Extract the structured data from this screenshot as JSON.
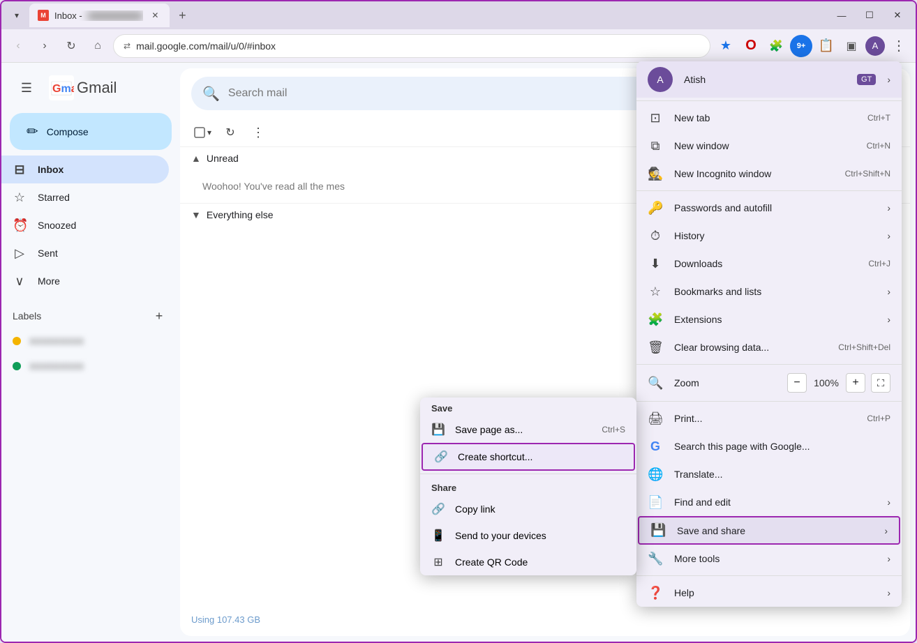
{
  "browser": {
    "tab": {
      "favicon": "M",
      "title": "Inbox -",
      "title_blurred": "     "
    },
    "address": "mail.google.com/mail/u/0/#inbox",
    "window_controls": {
      "minimize": "—",
      "maximize": "☐",
      "close": "✕"
    }
  },
  "toolbar_icons": {
    "star_label": "★",
    "opera_label": "O",
    "extension_label": "🧩",
    "extensions_badge": "9+",
    "clipboard_label": "📋",
    "sidebar_label": "▣",
    "profile_label": "👤",
    "menu_label": "⋮"
  },
  "gmail": {
    "logo_text": "Gmail",
    "compose_label": "Compose",
    "search_placeholder": "Search mail",
    "nav": [
      {
        "id": "inbox",
        "label": "Inbox",
        "icon": "⊟",
        "active": true
      },
      {
        "id": "starred",
        "label": "Starred",
        "icon": "☆",
        "active": false
      },
      {
        "id": "snoozed",
        "label": "Snoozed",
        "icon": "⏰",
        "active": false
      },
      {
        "id": "sent",
        "label": "Sent",
        "icon": "▷",
        "active": false
      },
      {
        "id": "more",
        "label": "More",
        "icon": "∨",
        "active": false
      }
    ],
    "labels_title": "Labels",
    "labels": [
      {
        "id": "label1",
        "color": "#f4b400",
        "text": "XXXXXXXXX"
      },
      {
        "id": "label2",
        "color": "#0f9d58",
        "text": "XXXXXXXXX"
      }
    ],
    "unread_section": "Unread",
    "unread_message": "Woohoo! You've read all the mes",
    "everything_else_section": "Everything else",
    "storage_info": "Using 107.43 GB"
  },
  "chrome_menu": {
    "user": {
      "name": "Atish",
      "badge": "GT",
      "avatar_initials": "A"
    },
    "items": [
      {
        "id": "new-tab",
        "icon": "⊡",
        "label": "New tab",
        "shortcut": "Ctrl+T",
        "arrow": ""
      },
      {
        "id": "new-window",
        "icon": "⧉",
        "label": "New window",
        "shortcut": "Ctrl+N",
        "arrow": ""
      },
      {
        "id": "new-incognito",
        "icon": "🕵",
        "label": "New Incognito window",
        "shortcut": "Ctrl+Shift+N",
        "arrow": ""
      },
      {
        "id": "passwords",
        "icon": "🔑",
        "label": "Passwords and autofill",
        "shortcut": "",
        "arrow": "›"
      },
      {
        "id": "history",
        "icon": "⏱",
        "label": "History",
        "shortcut": "",
        "arrow": "›"
      },
      {
        "id": "downloads",
        "icon": "⬇",
        "label": "Downloads",
        "shortcut": "Ctrl+J",
        "arrow": ""
      },
      {
        "id": "bookmarks",
        "icon": "☆",
        "label": "Bookmarks and lists",
        "shortcut": "",
        "arrow": "›"
      },
      {
        "id": "extensions",
        "icon": "🧩",
        "label": "Extensions",
        "shortcut": "",
        "arrow": "›"
      },
      {
        "id": "clear-browsing",
        "icon": "🗑",
        "label": "Clear browsing data...",
        "shortcut": "Ctrl+Shift+Del",
        "arrow": ""
      },
      {
        "id": "print",
        "icon": "🖨",
        "label": "Print...",
        "shortcut": "Ctrl+P",
        "arrow": ""
      },
      {
        "id": "search-google",
        "icon": "G",
        "label": "Search this page with Google...",
        "shortcut": "",
        "arrow": ""
      },
      {
        "id": "translate",
        "icon": "🌐",
        "label": "Translate...",
        "shortcut": "",
        "arrow": ""
      },
      {
        "id": "find-edit",
        "icon": "📄",
        "label": "Find and edit",
        "shortcut": "",
        "arrow": "›"
      },
      {
        "id": "save-share",
        "icon": "💾",
        "label": "Save and share",
        "shortcut": "",
        "arrow": "›",
        "highlighted": true
      },
      {
        "id": "more-tools",
        "icon": "🔧",
        "label": "More tools",
        "shortcut": "",
        "arrow": "›"
      },
      {
        "id": "help",
        "icon": "❓",
        "label": "Help",
        "shortcut": "",
        "arrow": "›"
      }
    ],
    "zoom": {
      "label": "Zoom",
      "minus": "−",
      "value": "100%",
      "plus": "+",
      "expand": "⛶"
    }
  },
  "sub_menu": {
    "save_section_title": "Save",
    "items": [
      {
        "id": "save-page",
        "icon": "💾",
        "label": "Save page as...",
        "shortcut": "Ctrl+S"
      },
      {
        "id": "create-shortcut",
        "icon": "🔗",
        "label": "Create shortcut...",
        "shortcut": "",
        "highlighted": true
      }
    ],
    "share_section_title": "Share",
    "share_items": [
      {
        "id": "copy-link",
        "icon": "🔗",
        "label": "Copy link",
        "shortcut": ""
      },
      {
        "id": "send-devices",
        "icon": "📱",
        "label": "Send to your devices",
        "shortcut": ""
      },
      {
        "id": "create-qr",
        "icon": "⊞",
        "label": "Create QR Code",
        "shortcut": ""
      }
    ]
  }
}
